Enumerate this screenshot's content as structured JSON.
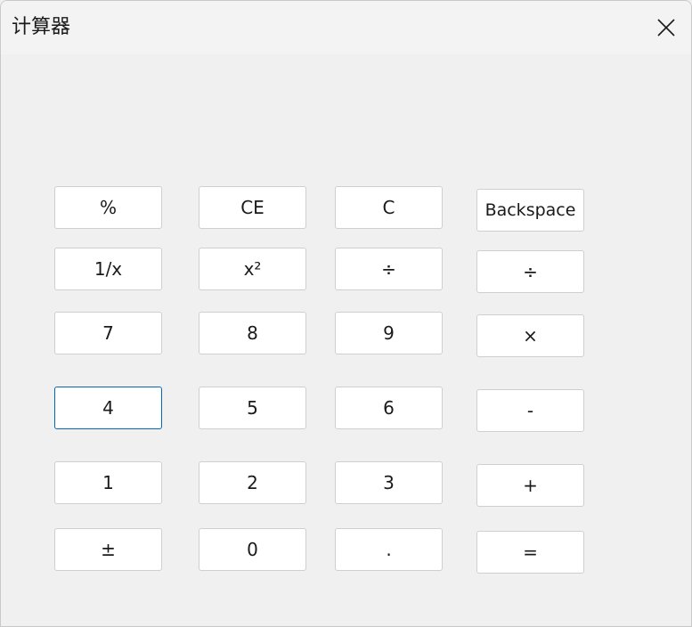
{
  "window": {
    "title": "计算器",
    "close_icon": "close-icon"
  },
  "keys": {
    "percent": "%",
    "clear_entry": "CE",
    "clear": "C",
    "backspace": "Backspace",
    "reciprocal": "1/x",
    "square": "x²",
    "divide_a": "÷",
    "divide_b": "÷",
    "seven": "7",
    "eight": "8",
    "nine": "9",
    "multiply": "×",
    "four": "4",
    "five": "5",
    "six": "6",
    "minus": "-",
    "one": "1",
    "two": "2",
    "three": "3",
    "plus": "+",
    "negate": "±",
    "zero": "0",
    "decimal": ".",
    "equals": "="
  }
}
